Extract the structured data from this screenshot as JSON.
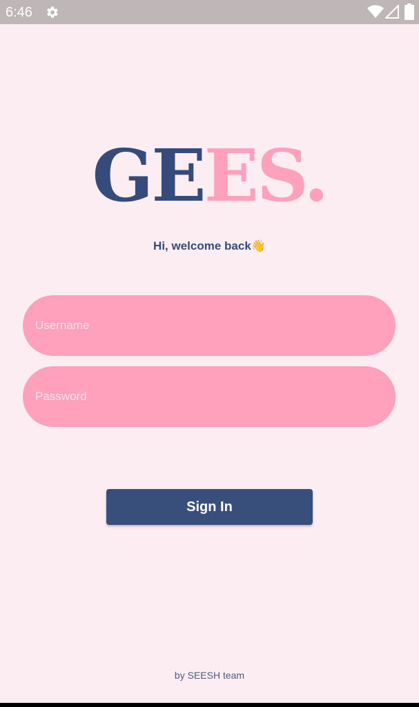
{
  "status_bar": {
    "time": "6:46",
    "icons": [
      "gear-icon",
      "wifi-icon",
      "signal-icon",
      "battery-icon"
    ]
  },
  "logo": {
    "part_dark": "GE",
    "part_pink": "ES.",
    "colors": {
      "dark": "#354b79",
      "pink": "#ffa1bd"
    }
  },
  "welcome": {
    "text": "Hi, welcome back",
    "emoji": "👋"
  },
  "form": {
    "username_placeholder": "Username",
    "password_placeholder": "Password",
    "sign_in_label": "Sign In"
  },
  "footer": {
    "text": "by SEESH team"
  },
  "colors": {
    "background": "#fcedf2",
    "status_bar": "#bfb6b8",
    "field": "#ffa1bd",
    "button": "#384f7c",
    "text_dark": "#354b79"
  }
}
